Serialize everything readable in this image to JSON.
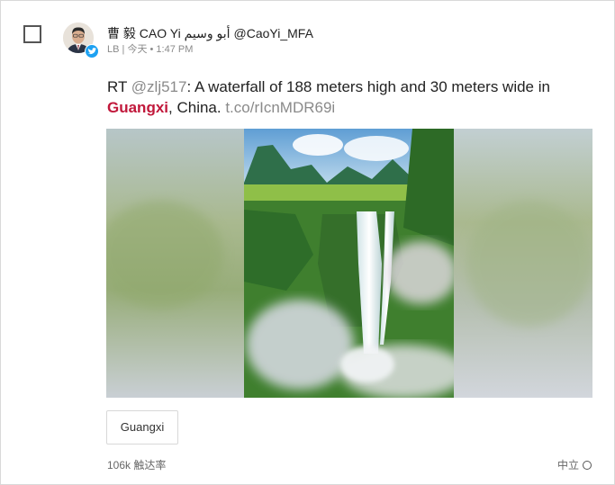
{
  "post": {
    "author_name": "曹 毅 CAO Yi أبو وسيم",
    "author_handle": "@CaoYi_MFA",
    "source": "LB",
    "separator": "|",
    "day": "今天",
    "time": "• 1:47 PM",
    "text_prefix": "RT ",
    "mention": "@zlj517",
    "text_body": ": A waterfall of 188 meters high and 30 meters wide in ",
    "hashtag": "Guangxi",
    "text_after_hashtag": ", China. ",
    "link": "t.co/rIcnMDR69i"
  },
  "tag_chip": "Guangxi",
  "stats": {
    "reach": "106k 触达率"
  },
  "sentiment": {
    "label": "中立"
  },
  "icons": {
    "badge": "twitter-bird-icon",
    "sentiment": "circle-icon"
  },
  "colors": {
    "hashtag": "#c1183b",
    "muted": "#8a8a8a",
    "twitter_blue": "#1da1f2"
  }
}
